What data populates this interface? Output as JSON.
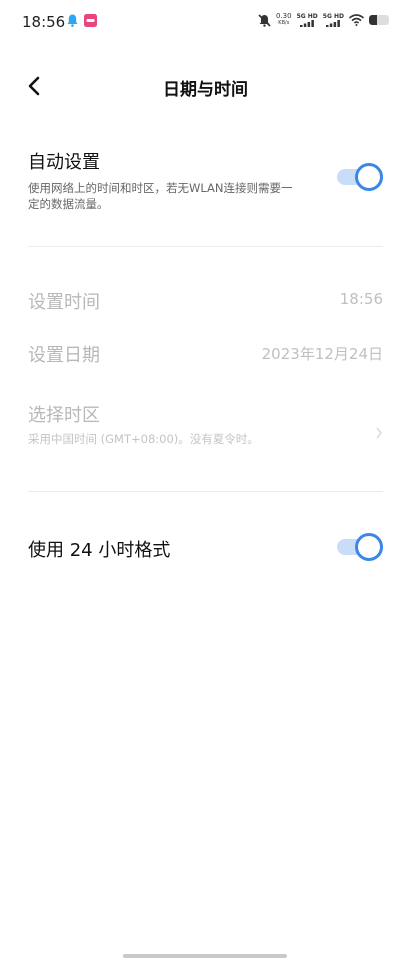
{
  "status_bar": {
    "time": "18:56",
    "net_speed_value": "0.30",
    "net_speed_unit": "KB/s",
    "signal1_label": "5G HD",
    "signal2_label": "5G HD",
    "battery_level": 0.4
  },
  "header": {
    "title": "日期与时间"
  },
  "settings": {
    "auto": {
      "title": "自动设置",
      "description": "使用网络上的时间和时区，若无WLAN连接则需要一定的数据流量。",
      "enabled": true
    },
    "set_time": {
      "title": "设置时间",
      "value": "18:56"
    },
    "set_date": {
      "title": "设置日期",
      "value": "2023年12月24日"
    },
    "timezone": {
      "title": "选择时区",
      "description": "采用中国时间 (GMT+08:00)。没有夏令时。"
    },
    "format24": {
      "title": "使用 24 小时格式",
      "enabled": true
    }
  },
  "colors": {
    "accent": "#3b86e8",
    "track": "#c9ddf8",
    "notif_bell": "#2ea7f2",
    "notif_app": "#e9457a"
  }
}
